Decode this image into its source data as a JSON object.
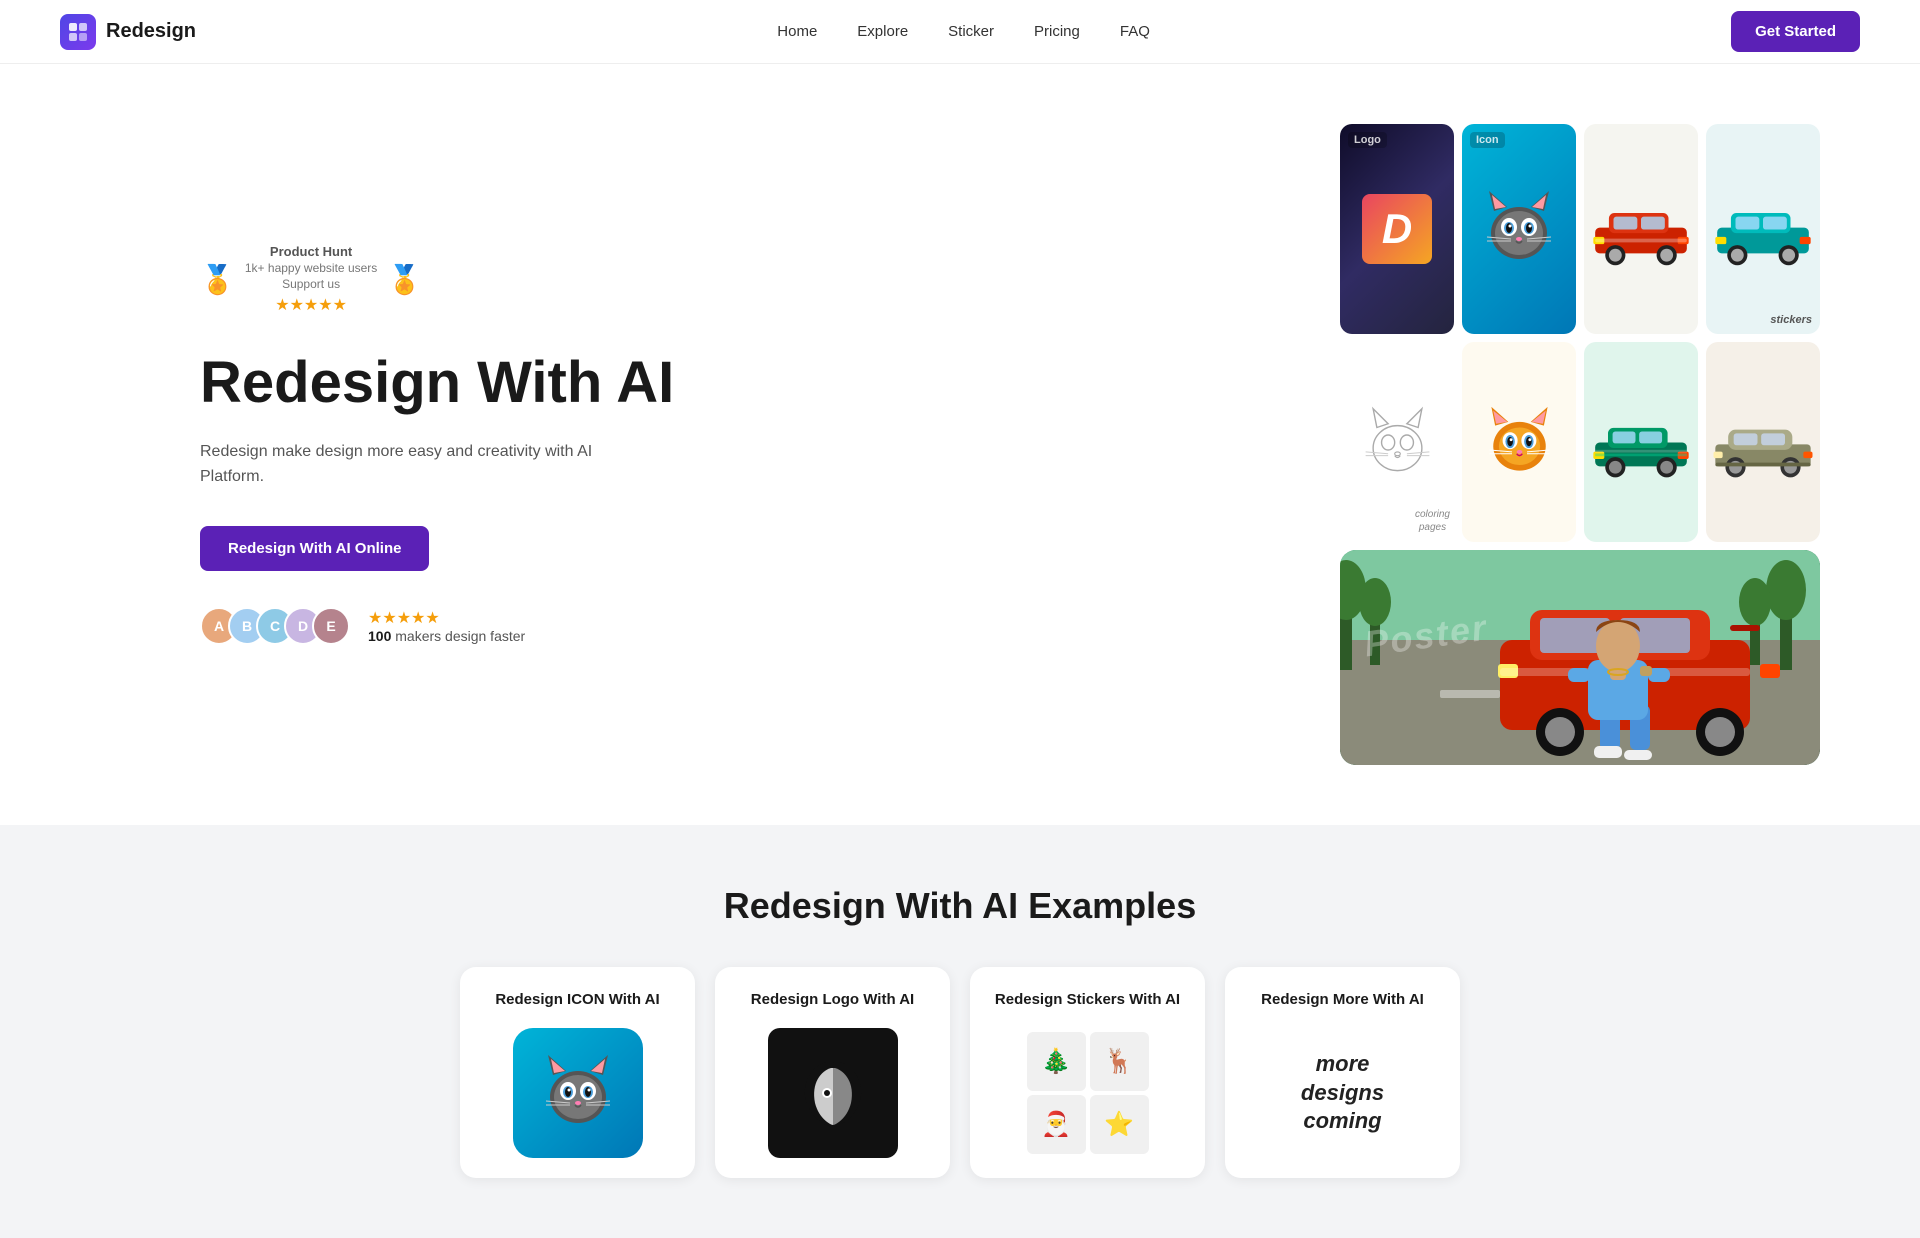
{
  "navbar": {
    "logo_text": "Redesign",
    "links": [
      {
        "label": "Home",
        "href": "#"
      },
      {
        "label": "Explore",
        "href": "#"
      },
      {
        "label": "Sticker",
        "href": "#"
      },
      {
        "label": "Pricing",
        "href": "#"
      },
      {
        "label": "FAQ",
        "href": "#"
      }
    ],
    "cta_label": "Get Started"
  },
  "hero": {
    "product_hunt_title": "Product Hunt",
    "product_hunt_sub": "1k+ happy website users",
    "product_hunt_support": "Support us",
    "heading": "Redesign With AI",
    "description": "Redesign make design more easy and creativity with AI Platform.",
    "cta_label": "Redesign With AI Online",
    "makers_count": "100",
    "makers_label": "makers design faster"
  },
  "examples": {
    "heading": "Redesign With AI Examples",
    "cards": [
      {
        "title": "Redesign ICON With AI"
      },
      {
        "title": "Redesign Logo With AI"
      },
      {
        "title": "Redesign Stickers With AI"
      },
      {
        "title": "Redesign More With AI"
      }
    ],
    "more_text": "more\ndesigns\ncoming"
  }
}
